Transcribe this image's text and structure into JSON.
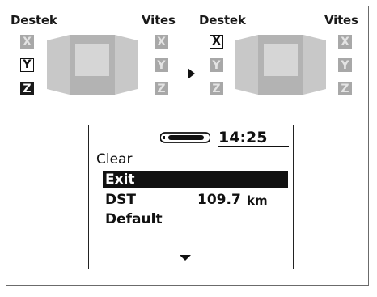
{
  "left_panel": {
    "label_left": "Destek",
    "label_right": "Vites",
    "left_keys": [
      "X",
      "Y",
      "Z"
    ],
    "right_keys": [
      "X",
      "Y",
      "Z"
    ]
  },
  "right_panel": {
    "label_left": "Destek",
    "label_right": "Vites",
    "left_keys": [
      "X",
      "Y",
      "Z"
    ],
    "right_keys": [
      "X",
      "Y",
      "Z"
    ]
  },
  "screen": {
    "time": "14:25",
    "title": "Clear",
    "menu": [
      {
        "label": "Exit",
        "selected": true
      },
      {
        "label": "DST",
        "value": "109.7",
        "unit": "km"
      },
      {
        "label": "Default"
      }
    ]
  },
  "icons": {
    "battery": "battery-icon",
    "scroll": "scroll-down-icon",
    "arrow": "transition-arrow-icon"
  }
}
